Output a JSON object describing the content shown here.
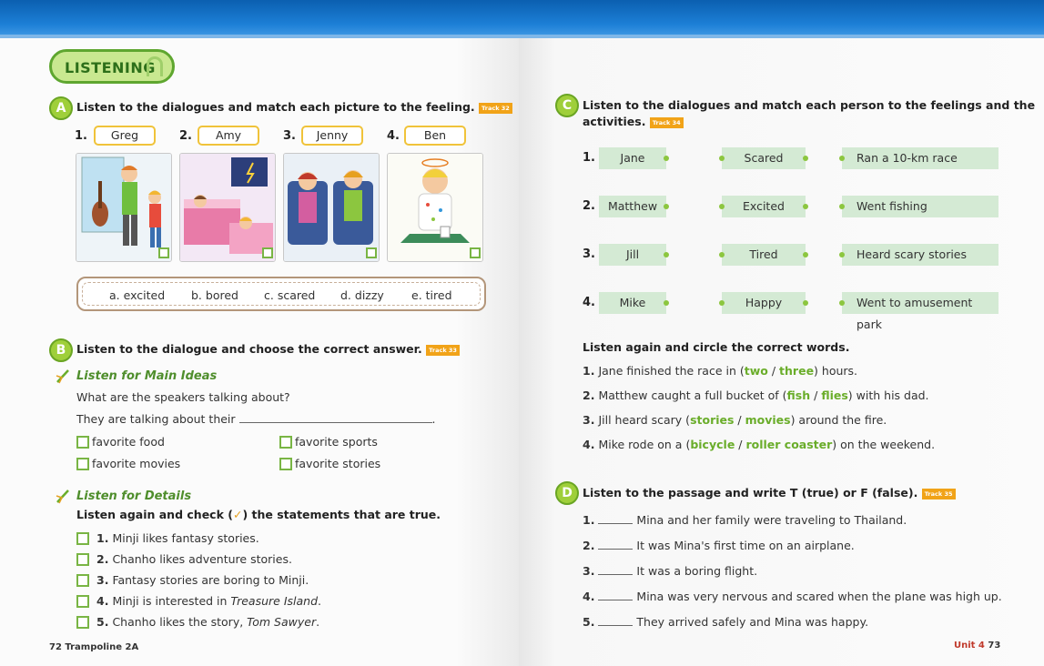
{
  "left": {
    "section_title": "LISTENING",
    "A": {
      "letter": "A",
      "instruction": "Listen to the dialogues and match each picture to the feeling.",
      "track": "Track 32",
      "names": [
        {
          "num": "1.",
          "name": "Greg"
        },
        {
          "num": "2.",
          "name": "Amy"
        },
        {
          "num": "3.",
          "name": "Jenny"
        },
        {
          "num": "4.",
          "name": "Ben"
        }
      ],
      "options": [
        "a. excited",
        "b. bored",
        "c. scared",
        "d. dizzy",
        "e. tired"
      ]
    },
    "B": {
      "letter": "B",
      "instruction": "Listen to the dialogue and choose the correct answer.",
      "track": "Track 33",
      "main_ideas_title": "Listen for Main Ideas",
      "question": "What are the speakers talking about?",
      "prompt": "They are talking about their",
      "prompt_end": ".",
      "choices": [
        "favorite food",
        "favorite sports",
        "favorite movies",
        "favorite stories"
      ],
      "details_title": "Listen for Details",
      "details_instruction_a": "Listen again and check (",
      "details_instruction_b": ") the statements that are true.",
      "statements": [
        {
          "num": "1.",
          "text": "Minji likes fantasy stories.",
          "italic": ""
        },
        {
          "num": "2.",
          "text": "Chanho likes adventure stories.",
          "italic": ""
        },
        {
          "num": "3.",
          "text": "Fantasy stories are boring to Minji.",
          "italic": ""
        },
        {
          "num": "4.",
          "text": "Minji is interested in ",
          "italic": "Treasure Island",
          "tail": "."
        },
        {
          "num": "5.",
          "text": "Chanho likes the story, ",
          "italic": "Tom Sawyer",
          "tail": "."
        }
      ]
    },
    "footer": {
      "page": "72",
      "book": "Trampoline 2A"
    }
  },
  "right": {
    "C": {
      "letter": "C",
      "instruction_line1": "Listen to the dialogues and match each person to the feelings and the",
      "instruction_line2": "activities.",
      "track": "Track 34",
      "rows": [
        {
          "num": "1.",
          "person": "Jane",
          "feeling": "Scared",
          "activity": "Ran a 10-km race"
        },
        {
          "num": "2.",
          "person": "Matthew",
          "feeling": "Excited",
          "activity": "Went fishing"
        },
        {
          "num": "3.",
          "person": "Jill",
          "feeling": "Tired",
          "activity": "Heard scary stories"
        },
        {
          "num": "4.",
          "person": "Mike",
          "feeling": "Happy",
          "activity": "Went to amusement park"
        }
      ],
      "circle_title": "Listen again and circle the correct words.",
      "circle_items": [
        {
          "num": "1.",
          "pre": "Jane finished the race in (",
          "a": "two",
          "b": "three",
          "post": ") hours."
        },
        {
          "num": "2.",
          "pre": "Matthew caught a full bucket of (",
          "a": "fish",
          "b": "flies",
          "post": ") with his dad."
        },
        {
          "num": "3.",
          "pre": "Jill heard scary (",
          "a": "stories",
          "b": "movies",
          "post": ") around the fire."
        },
        {
          "num": "4.",
          "pre": "Mike rode on a (",
          "a": "bicycle",
          "b": "roller coaster",
          "post": ") on the weekend."
        }
      ],
      "slash": " / "
    },
    "D": {
      "letter": "D",
      "instruction": "Listen to the passage and write T (true) or F (false).",
      "track": "Track 35",
      "statements": [
        {
          "num": "1.",
          "text": "Mina and her family were traveling to Thailand."
        },
        {
          "num": "2.",
          "text": "It was Mina's first time on an airplane."
        },
        {
          "num": "3.",
          "text": "It was a boring flight."
        },
        {
          "num": "4.",
          "text": "Mina was very nervous and scared when the plane was high up."
        },
        {
          "num": "5.",
          "text": "They arrived safely and Mina was happy."
        }
      ]
    },
    "footer": {
      "unit": "Unit 4",
      "page": "73"
    }
  },
  "colors": {
    "accent_green": "#8cc63f",
    "topbar_blue": "#1c7fd6",
    "track_orange": "#f1a318",
    "name_border": "#f0c33a",
    "match_box": "#d4ead4"
  }
}
